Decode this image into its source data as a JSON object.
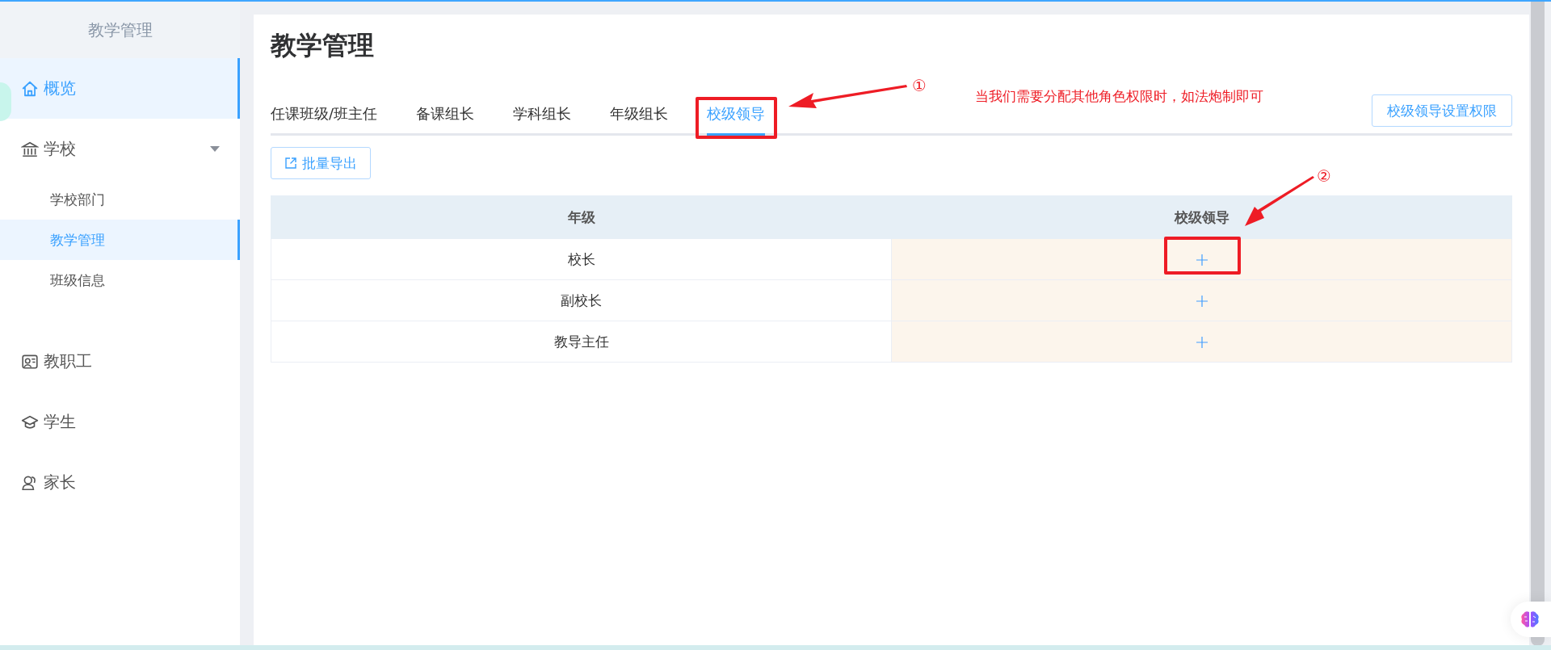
{
  "sidebar": {
    "title": "教学管理",
    "items": [
      {
        "label": "概览",
        "kind": "home",
        "selected": true
      },
      {
        "label": "学校",
        "kind": "bank",
        "selected": false,
        "expanded": true,
        "children": [
          {
            "label": "学校部门",
            "selected": false
          },
          {
            "label": "教学管理",
            "selected": true
          },
          {
            "label": "班级信息",
            "selected": false
          }
        ]
      },
      {
        "label": "教职工",
        "kind": "staff",
        "selected": false
      },
      {
        "label": "学生",
        "kind": "cap",
        "selected": false
      },
      {
        "label": "家长",
        "kind": "people",
        "selected": false
      }
    ]
  },
  "page": {
    "title": "教学管理",
    "tabs": [
      {
        "label": "任课班级/班主任",
        "selected": false
      },
      {
        "label": "备课组长",
        "selected": false
      },
      {
        "label": "学科组长",
        "selected": false
      },
      {
        "label": "年级组长",
        "selected": false
      },
      {
        "label": "校级领导",
        "selected": true
      }
    ],
    "settings_button": "校级领导设置权限",
    "export_button": "批量导出",
    "table": {
      "columns": [
        "年级",
        "校级领导"
      ],
      "rows": [
        {
          "grade": "校长"
        },
        {
          "grade": "副校长"
        },
        {
          "grade": "教导主任"
        }
      ]
    }
  },
  "annotations": {
    "marks": [
      "①",
      "②"
    ],
    "note": "当我们需要分配其他角色权限时，如法炮制即可"
  }
}
